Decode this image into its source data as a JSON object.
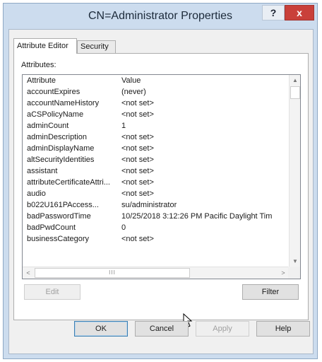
{
  "window": {
    "title": "CN=Administrator Properties",
    "help_glyph": "?",
    "close_glyph": "x"
  },
  "tabs": [
    {
      "label": "Attribute Editor",
      "active": true
    },
    {
      "label": "Security",
      "active": false
    }
  ],
  "attributes": {
    "label": "Attributes:",
    "columns": {
      "attribute": "Attribute",
      "value": "Value"
    },
    "rows": [
      {
        "attribute": "accountExpires",
        "value": "(never)"
      },
      {
        "attribute": "accountNameHistory",
        "value": "<not set>"
      },
      {
        "attribute": "aCSPolicyName",
        "value": "<not set>"
      },
      {
        "attribute": "adminCount",
        "value": "1"
      },
      {
        "attribute": "adminDescription",
        "value": "<not set>"
      },
      {
        "attribute": "adminDisplayName",
        "value": "<not set>"
      },
      {
        "attribute": "altSecurityIdentities",
        "value": "<not set>"
      },
      {
        "attribute": "assistant",
        "value": "<not set>"
      },
      {
        "attribute": "attributeCertificateAttri...",
        "value": "<not set>"
      },
      {
        "attribute": "audio",
        "value": "<not set>"
      },
      {
        "attribute": "b022U161PAccess...",
        "value": "su/administrator"
      },
      {
        "attribute": "badPasswordTime",
        "value": "10/25/2018 3:12:26 PM Pacific Daylight Tim"
      },
      {
        "attribute": "badPwdCount",
        "value": "0"
      },
      {
        "attribute": "businessCategory",
        "value": "<not set>"
      }
    ]
  },
  "scrollbar": {
    "up_glyph": "▲",
    "down_glyph": "▼",
    "left_glyph": "<",
    "right_glyph": ">",
    "thumb_grip": "III"
  },
  "buttons": {
    "edit": "Edit",
    "filter": "Filter",
    "ok": "OK",
    "cancel": "Cancel",
    "apply": "Apply",
    "help": "Help"
  }
}
